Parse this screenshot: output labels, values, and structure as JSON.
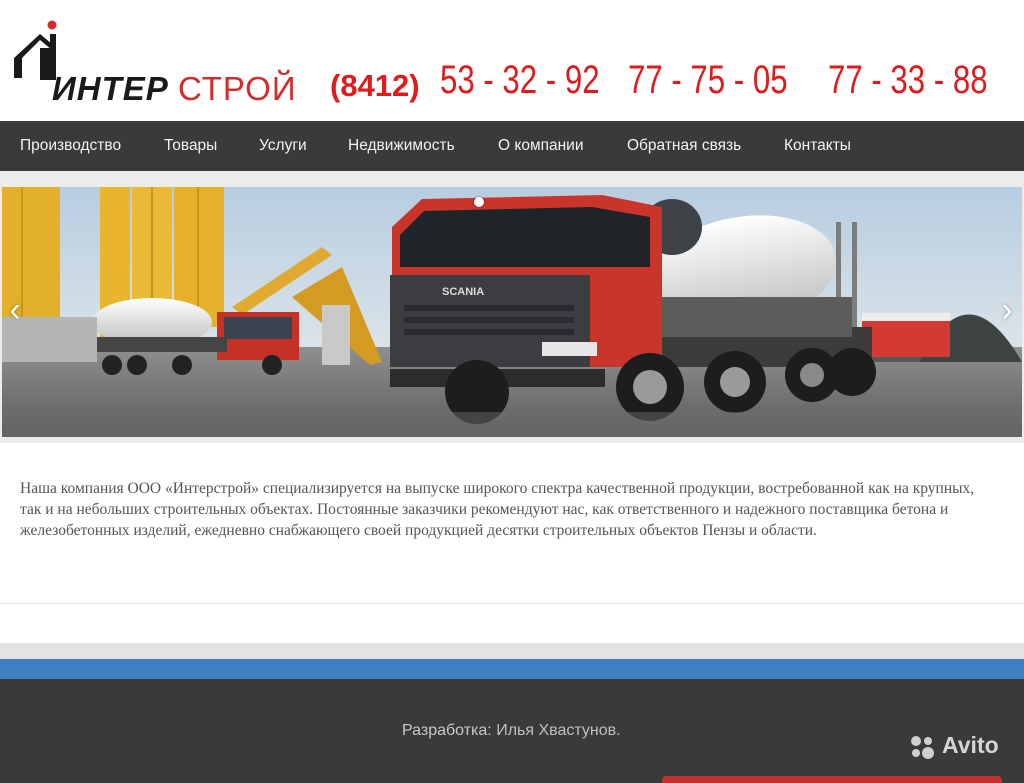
{
  "header": {
    "logo_left": "ИНТЕР",
    "logo_right": "СТРОЙ",
    "phone_code": "(8412)",
    "phones": [
      "53 - 32 - 92",
      "77 - 75 - 05",
      "77 - 33 - 88"
    ]
  },
  "nav": {
    "items": [
      "Производство",
      "Товары",
      "Услуги",
      "Недвижимость",
      "О компании",
      "Обратная связь",
      "Контакты"
    ]
  },
  "slider": {
    "image": "concrete-mixer-trucks",
    "truck_brand": "SCANIA",
    "prev_icon": "chevron-left-icon",
    "next_icon": "chevron-right-icon"
  },
  "content": {
    "text": "Наша компания ООО «Интерстрой» специализируется на выпуске широкого спектра качественной продукции, востребованной как на крупных, так и на небольших строительных объектах. Постоянные заказчики рекомендуют нас, как ответственного и надежного поставщика бетона и железобетонных изделий, ежедневно снабжающего своей продукцией десятки строительных объектов Пензы и области."
  },
  "footer": {
    "credit_label": "Разработка:",
    "credit_name": "Илья Хвастунов."
  },
  "watermark": {
    "text": "Avito"
  },
  "colors": {
    "nav_bg": "#3a3a3a",
    "phone": "#e01b1b",
    "accent_blue": "#3f7fc1",
    "logo_red": "#d62b2b"
  }
}
